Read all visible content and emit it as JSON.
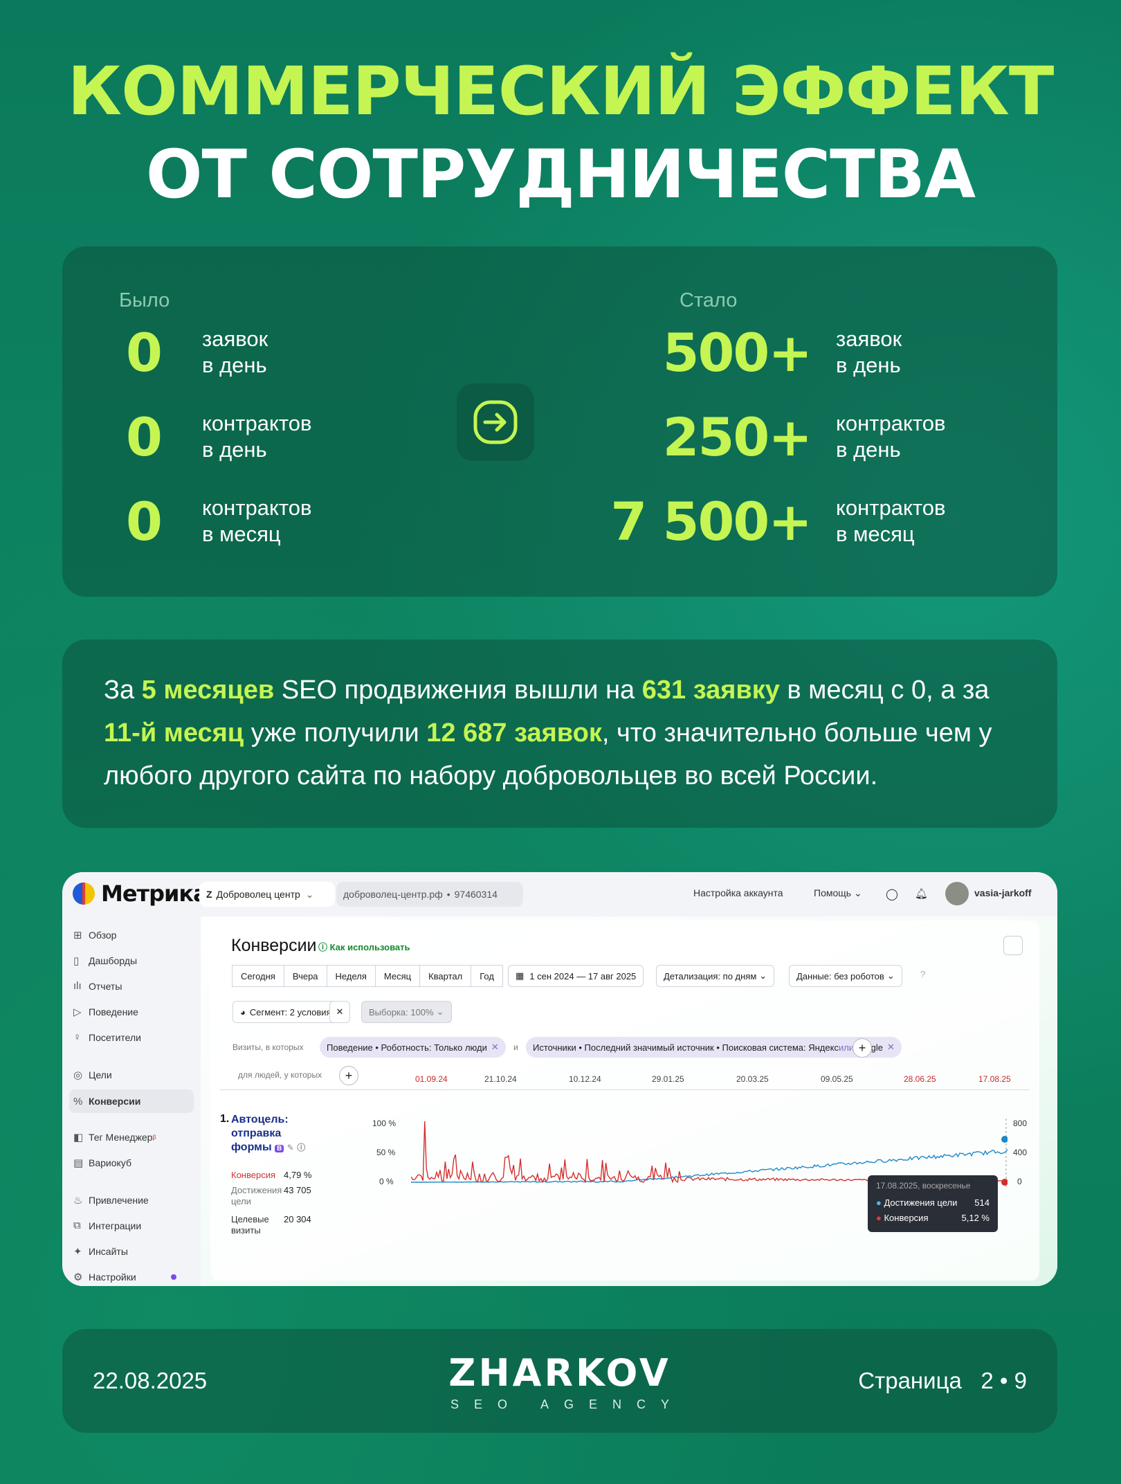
{
  "title": {
    "line1": "КОММЕРЧЕСКИЙ ЭФФЕКТ",
    "line2": "ОТ СОТРУДНИЧЕСТВА"
  },
  "stats": {
    "before_label": "Было",
    "after_label": "Стало",
    "before": [
      {
        "value": "0",
        "unit1": "заявок",
        "unit2": "в день"
      },
      {
        "value": "0",
        "unit1": "контрактов",
        "unit2": "в день"
      },
      {
        "value": "0",
        "unit1": "контрактов",
        "unit2": "в месяц"
      }
    ],
    "after": [
      {
        "value": "500+",
        "unit1": "заявок",
        "unit2": "в день"
      },
      {
        "value": "250+",
        "unit1": "контрактов",
        "unit2": "в день"
      },
      {
        "value": "7 500+",
        "unit1": "контрактов",
        "unit2": "в месяц"
      }
    ],
    "arrow_icon": "arrow-right-circle-icon"
  },
  "summary": {
    "p1": "За ",
    "h1": "5 месяцев",
    "p2": " SEO продвижения вышли на ",
    "h2": "631 заявку",
    "p3": " в месяц с 0, а за ",
    "h3": "11-й месяц",
    "p4": " уже получили ",
    "h4": "12 687 заявок",
    "p5": ",  что значительно больше чем у любого другого сайта по набору добровольцев во всей России."
  },
  "metrica": {
    "logo": "Метрика",
    "counter_name": "Доброволец центр",
    "counter_site": "доброволец-центр.рф",
    "counter_id": "97460314",
    "account_settings": "Настройка аккаунта",
    "help": "Помощь",
    "user": "vasia-jarkoff",
    "sidebar": [
      "Обзор",
      "Дашборды",
      "Отчеты",
      "Поведение",
      "Посетители",
      "Цели",
      "Конверсии",
      "Тег Менеджер",
      "Вариокуб",
      "Привлечение",
      "Интеграции",
      "Инсайты",
      "Настройки"
    ],
    "sidebar_badge": "β",
    "report_title": "Конверсии",
    "howto": "Как использовать",
    "periods": [
      "Сегодня",
      "Вчера",
      "Неделя",
      "Месяц",
      "Квартал",
      "Год"
    ],
    "date_range": "1 сен 2024 — 17 авг 2025",
    "detail": "Детализация: по дням",
    "data_filter": "Данные: без роботов",
    "segment": "Сегмент: 2 условия",
    "sample": "Выборка: 100%",
    "visits_label": "Визиты, в которых",
    "chip1": "Поведение • Роботность: Только люди",
    "and": "и",
    "chip2_a": "Источники • Последний значимый источник • Поисковая система: Яндекс ",
    "chip2_or": "или",
    "chip2_b": " Google",
    "people_label": "для людей, у которых",
    "dates": [
      "01.09.24",
      "21.10.24",
      "10.12.24",
      "29.01.25",
      "20.03.25",
      "09.05.25",
      "28.06.25",
      "17.08.25"
    ],
    "goal_num": "1.",
    "goal_title": [
      "Автоцель:",
      "отправка",
      "формы"
    ],
    "metrics": [
      {
        "label": "Конверсия",
        "value": "4,79 %"
      },
      {
        "label": "Достижения цели",
        "value": "43 705"
      },
      {
        "label": "Целевые визиты",
        "value": "20 304"
      }
    ],
    "axis_left": [
      "100 %",
      "50 %",
      "0 %"
    ],
    "axis_right": [
      "800",
      "400",
      "0"
    ],
    "tooltip": {
      "date": "17.08.2025, воскресенье",
      "row1_label": "Достижения цели",
      "row1_value": "514",
      "row2_label": "Конверсия",
      "row2_value": "5,12 %"
    },
    "colors": {
      "conversion": "#d32f2f",
      "goals": "#1e88c8"
    }
  },
  "footer": {
    "date": "22.08.2025",
    "brand": "ZHARKOV",
    "sub": "SEO AGENCY",
    "page_label": "Страница",
    "page_current": "2",
    "page_sep": "•",
    "page_total": "9"
  },
  "colors": {
    "accent": "#c5f552",
    "bg": "#0b7a5c"
  }
}
